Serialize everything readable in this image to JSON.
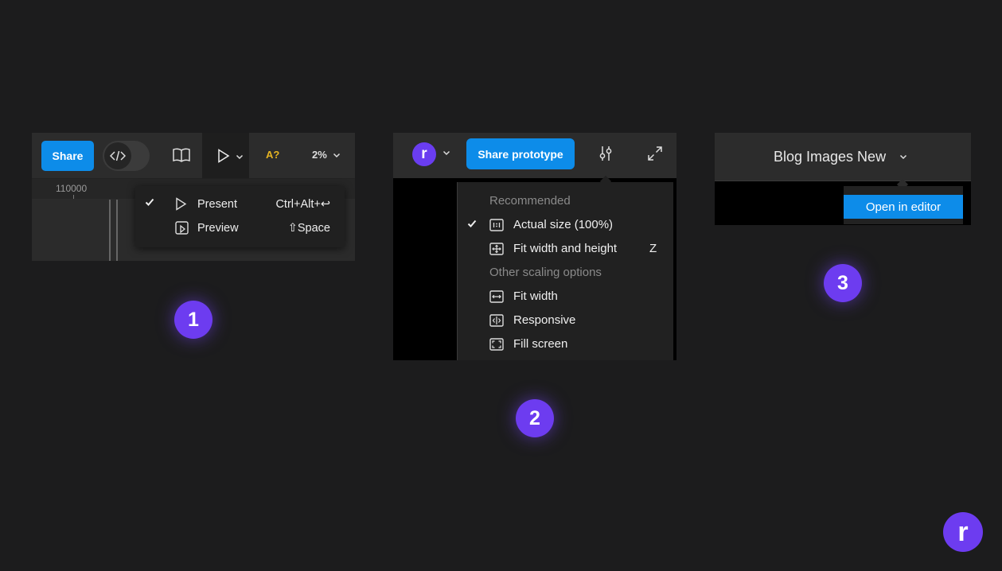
{
  "panel1": {
    "share_label": "Share",
    "aa_label": "A?",
    "zoom_label": "2%",
    "ruler_label": "110000",
    "menu": {
      "present_label": "Present",
      "present_shortcut": "Ctrl+Alt+↩",
      "preview_label": "Preview",
      "preview_shortcut": "⇧Space"
    },
    "icons": [
      "code-icon",
      "book-icon",
      "play-icon",
      "chevron-down-icon"
    ],
    "badge": "1"
  },
  "panel2": {
    "avatar_letter": "r",
    "share_label": "Share prototype",
    "menu": {
      "recommended_header": "Recommended",
      "actual_size_label": "Actual size (100%)",
      "fit_wh_label": "Fit width and height",
      "fit_wh_shortcut": "Z",
      "other_header": "Other scaling options",
      "fit_width_label": "Fit width",
      "responsive_label": "Responsive",
      "fill_screen_label": "Fill screen"
    },
    "badge": "2"
  },
  "panel3": {
    "title": "Blog Images New",
    "open_label": "Open in editor",
    "badge": "3"
  },
  "logo_letter": "r",
  "colors": {
    "background": "#1c1c1d",
    "accent_blue": "#0d8ce9",
    "badge_purple": "#6d3cf0",
    "toolbar": "#2c2c2c"
  }
}
